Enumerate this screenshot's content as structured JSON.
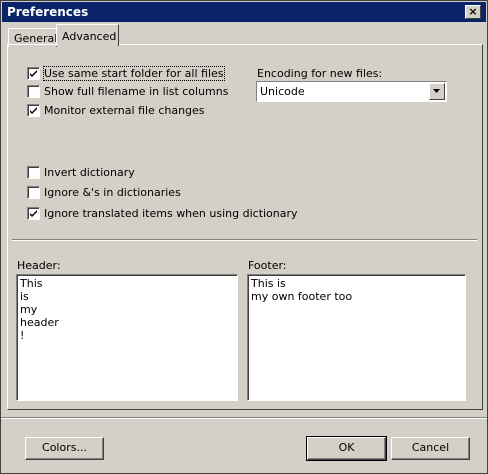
{
  "window": {
    "title": "Preferences",
    "close_symbol": "×"
  },
  "tabs": [
    {
      "label": "General",
      "active": false
    },
    {
      "label": "Advanced",
      "active": true
    }
  ],
  "options_top": [
    {
      "label": "Use same start folder for all files",
      "checked": true
    },
    {
      "label": "Show full filename in list columns",
      "checked": false
    },
    {
      "label": "Monitor external file changes",
      "checked": true
    }
  ],
  "encoding": {
    "label": "Encoding for new files:",
    "selected": "Unicode"
  },
  "options_dict": [
    {
      "label": "Invert dictionary",
      "checked": false
    },
    {
      "label": "Ignore &'s in dictionaries",
      "checked": false
    },
    {
      "label": "Ignore translated items when using dictionary",
      "checked": true
    }
  ],
  "header": {
    "label": "Header:",
    "lines": [
      "This",
      "is",
      "my",
      "header",
      "!"
    ]
  },
  "footer": {
    "label": "Footer:",
    "lines": [
      "This is",
      "my own footer too"
    ]
  },
  "buttons": {
    "colors": "Colors...",
    "ok": "OK",
    "cancel": "Cancel"
  }
}
